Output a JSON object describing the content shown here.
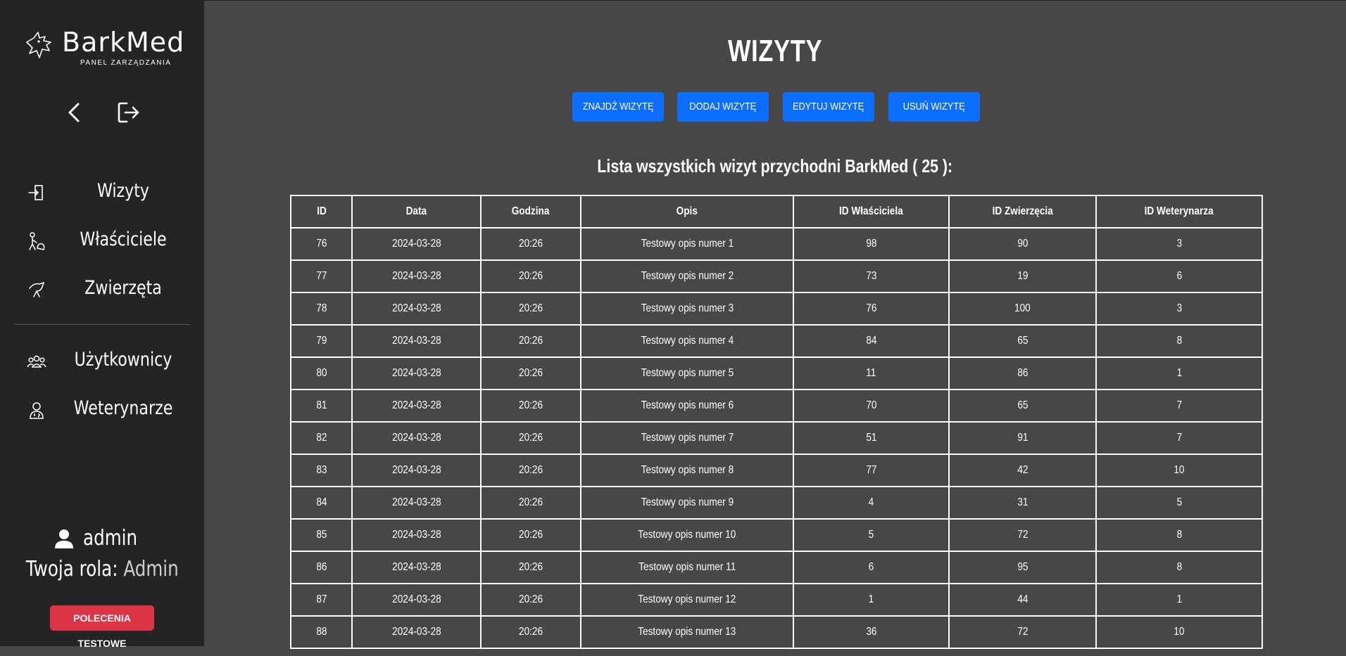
{
  "sidebar": {
    "logo_text": "BarkMed",
    "logo_subtitle": "PANEL ZARZĄDZANIA",
    "menu": [
      {
        "label": "Wizyty",
        "icon": "enter-icon"
      },
      {
        "label": "Właściciele",
        "icon": "owner-icon"
      },
      {
        "label": "Zwierzęta",
        "icon": "animal-icon"
      },
      {
        "label": "Użytkownicy",
        "icon": "users-icon"
      },
      {
        "label": "Weterynarze",
        "icon": "vet-icon"
      }
    ],
    "user": {
      "name": "admin",
      "role_label": "Twoja rola:",
      "role_value": "Admin"
    },
    "test_button": "POLECENIA TESTOWE"
  },
  "main": {
    "title": "WIZYTY",
    "buttons": {
      "find": "ZNAJDŹ WIZYTĘ",
      "add": "DODAJ WIZYTĘ",
      "edit": "EDYTUJ WIZYTĘ",
      "delete": "USUŃ WIZYTĘ"
    },
    "list_caption": "Lista wszystkich wizyt przychodni BarkMed ( 25 ):",
    "table": {
      "columns": [
        "ID",
        "Data",
        "Godzina",
        "Opis",
        "ID Właściciela",
        "ID Zwierzęcia",
        "ID Weterynarza"
      ],
      "rows": [
        [
          "76",
          "2024-03-28",
          "20:26",
          "Testowy opis numer 1",
          "98",
          "90",
          "3"
        ],
        [
          "77",
          "2024-03-28",
          "20:26",
          "Testowy opis numer 2",
          "73",
          "19",
          "6"
        ],
        [
          "78",
          "2024-03-28",
          "20:26",
          "Testowy opis numer 3",
          "76",
          "100",
          "3"
        ],
        [
          "79",
          "2024-03-28",
          "20:26",
          "Testowy opis numer 4",
          "84",
          "65",
          "8"
        ],
        [
          "80",
          "2024-03-28",
          "20:26",
          "Testowy opis numer 5",
          "11",
          "86",
          "1"
        ],
        [
          "81",
          "2024-03-28",
          "20:26",
          "Testowy opis numer 6",
          "70",
          "65",
          "7"
        ],
        [
          "82",
          "2024-03-28",
          "20:26",
          "Testowy opis numer 7",
          "51",
          "91",
          "7"
        ],
        [
          "83",
          "2024-03-28",
          "20:26",
          "Testowy opis numer 8",
          "77",
          "42",
          "10"
        ],
        [
          "84",
          "2024-03-28",
          "20:26",
          "Testowy opis numer 9",
          "4",
          "31",
          "5"
        ],
        [
          "85",
          "2024-03-28",
          "20:26",
          "Testowy opis numer 10",
          "5",
          "72",
          "8"
        ],
        [
          "86",
          "2024-03-28",
          "20:26",
          "Testowy opis numer 11",
          "6",
          "95",
          "8"
        ],
        [
          "87",
          "2024-03-28",
          "20:26",
          "Testowy opis numer 12",
          "1",
          "44",
          "1"
        ],
        [
          "88",
          "2024-03-28",
          "20:26",
          "Testowy opis numer 13",
          "36",
          "72",
          "10"
        ]
      ]
    }
  },
  "colors": {
    "sidebar_bg": "#242424",
    "main_bg": "#474747",
    "primary_button": "#0d6efd",
    "danger_button": "#dc3545"
  }
}
